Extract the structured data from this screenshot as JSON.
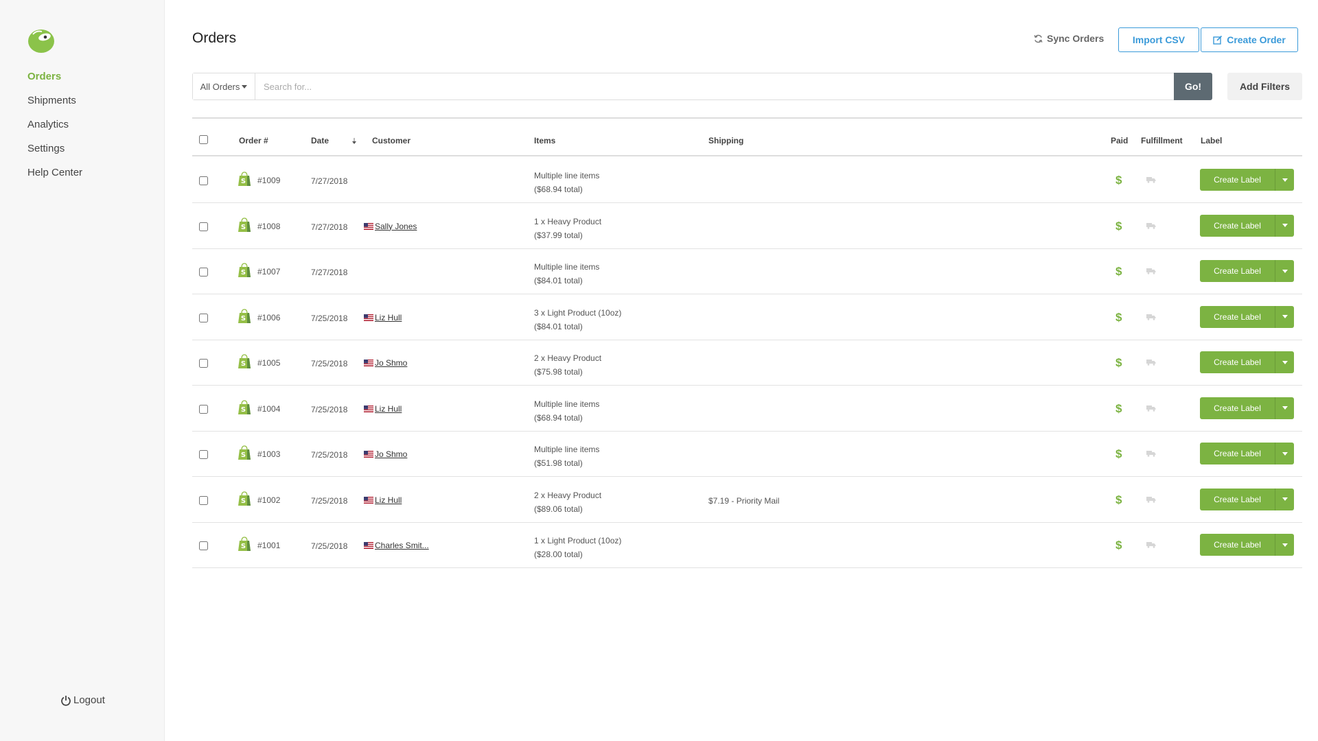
{
  "sidebar": {
    "nav": [
      {
        "label": "Orders",
        "active": true
      },
      {
        "label": "Shipments",
        "active": false
      },
      {
        "label": "Analytics",
        "active": false
      },
      {
        "label": "Settings",
        "active": false
      },
      {
        "label": "Help Center",
        "active": false
      }
    ],
    "logout_label": "Logout"
  },
  "header": {
    "title": "Orders",
    "sync_label": "Sync Orders",
    "import_label": "Import CSV",
    "create_order_label": "Create Order"
  },
  "search": {
    "filter_value": "All Orders",
    "placeholder": "Search for...",
    "go_label": "Go!",
    "add_filters_label": "Add Filters"
  },
  "table": {
    "columns": {
      "order": "Order #",
      "date": "Date",
      "customer": "Customer",
      "items": "Items",
      "shipping": "Shipping",
      "paid": "Paid",
      "fulfillment": "Fulfillment",
      "label": "Label"
    },
    "rows": [
      {
        "order": "#1009",
        "date": "7/27/2018",
        "customer": "",
        "items_line1": "Multiple line items",
        "items_line2": "($68.94 total)",
        "shipping": "",
        "paid": "$",
        "label_button": "Create Label"
      },
      {
        "order": "#1008",
        "date": "7/27/2018",
        "customer": "Sally Jones",
        "items_line1": "1 x Heavy Product",
        "items_line2": "($37.99 total)",
        "shipping": "",
        "paid": "$",
        "label_button": "Create Label"
      },
      {
        "order": "#1007",
        "date": "7/27/2018",
        "customer": "",
        "items_line1": "Multiple line items",
        "items_line2": "($84.01 total)",
        "shipping": "",
        "paid": "$",
        "label_button": "Create Label"
      },
      {
        "order": "#1006",
        "date": "7/25/2018",
        "customer": "Liz Hull",
        "items_line1": "3 x Light Product (10oz)",
        "items_line2": "($84.01 total)",
        "shipping": "",
        "paid": "$",
        "label_button": "Create Label"
      },
      {
        "order": "#1005",
        "date": "7/25/2018",
        "customer": "Jo Shmo",
        "items_line1": "2 x Heavy Product",
        "items_line2": "($75.98 total)",
        "shipping": "",
        "paid": "$",
        "label_button": "Create Label"
      },
      {
        "order": "#1004",
        "date": "7/25/2018",
        "customer": "Liz Hull",
        "items_line1": "Multiple line items",
        "items_line2": "($68.94 total)",
        "shipping": "",
        "paid": "$",
        "label_button": "Create Label"
      },
      {
        "order": "#1003",
        "date": "7/25/2018",
        "customer": "Jo Shmo",
        "items_line1": "Multiple line items",
        "items_line2": "($51.98 total)",
        "shipping": "",
        "paid": "$",
        "label_button": "Create Label"
      },
      {
        "order": "#1002",
        "date": "7/25/2018",
        "customer": "Liz Hull",
        "items_line1": "2 x Heavy Product",
        "items_line2": "($89.06 total)",
        "shipping": "$7.19 - Priority Mail",
        "paid": "$",
        "label_button": "Create Label"
      },
      {
        "order": "#1001",
        "date": "7/25/2018",
        "customer": "Charles Smit...",
        "items_line1": "1 x Light Product (10oz)",
        "items_line2": "($28.00 total)",
        "shipping": "",
        "paid": "$",
        "label_button": "Create Label"
      }
    ]
  },
  "colors": {
    "accent_green": "#7cb342",
    "accent_blue": "#3a9ad9",
    "go_button": "#5d6a72"
  },
  "icons": [
    "logo-icon",
    "power-icon",
    "sync-icon",
    "edit-icon",
    "caret-down-icon",
    "sort-icon",
    "shopify-bag-icon",
    "us-flag-icon",
    "truck-icon"
  ]
}
